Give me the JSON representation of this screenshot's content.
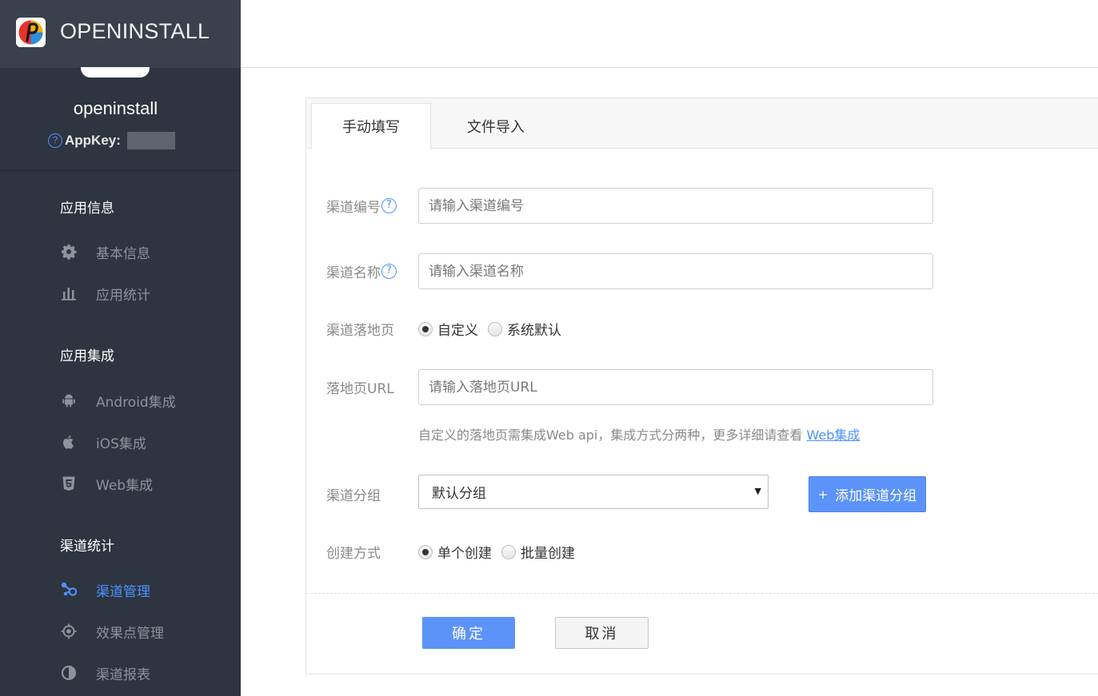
{
  "brand": {
    "logo_text": "OPENINSTALL",
    "logo_icon": "openinstall-logo"
  },
  "app": {
    "name": "openinstall",
    "appkey_label": "AppKey:"
  },
  "sidebar": {
    "groups": [
      {
        "title": "应用信息",
        "items": [
          {
            "label": "基本信息",
            "icon": "gear-icon"
          },
          {
            "label": "应用统计",
            "icon": "bar-chart-icon"
          }
        ]
      },
      {
        "title": "应用集成",
        "items": [
          {
            "label": "Android集成",
            "icon": "android-icon"
          },
          {
            "label": "iOS集成",
            "icon": "apple-icon"
          },
          {
            "label": "Web集成",
            "icon": "html5-icon"
          }
        ]
      },
      {
        "title": "渠道统计",
        "items": [
          {
            "label": "渠道管理",
            "icon": "channel-icon",
            "active": true
          },
          {
            "label": "效果点管理",
            "icon": "target-icon"
          },
          {
            "label": "渠道报表",
            "icon": "half-circle-icon"
          }
        ]
      }
    ],
    "active_color": "#4d90fe"
  },
  "tabs": [
    {
      "label": "手动填写",
      "active": true
    },
    {
      "label": "文件导入",
      "active": false
    }
  ],
  "form": {
    "channel_no": {
      "label": "渠道编号",
      "placeholder": "请输入渠道编号",
      "value": ""
    },
    "channel_name": {
      "label": "渠道名称",
      "placeholder": "请输入渠道名称",
      "value": ""
    },
    "landing": {
      "label": "渠道落地页",
      "options": [
        "自定义",
        "系统默认"
      ],
      "selected": "自定义"
    },
    "landing_url": {
      "label": "落地页URL",
      "placeholder": "请输入落地页URL",
      "value": ""
    },
    "hint": {
      "text": "自定义的落地页需集成Web api，集成方式分两种，更多详细请查看 ",
      "link": "Web集成"
    },
    "group": {
      "label": "渠道分组",
      "selected": "默认分组",
      "add_button": "添加渠道分组"
    },
    "create_mode": {
      "label": "创建方式",
      "options": [
        "单个创建",
        "批量创建"
      ],
      "selected": "单个创建"
    }
  },
  "actions": {
    "confirm": "确定",
    "cancel": "取消"
  },
  "colors": {
    "primary": "#5c93f8",
    "sidebar_bg": "#2e3440"
  }
}
